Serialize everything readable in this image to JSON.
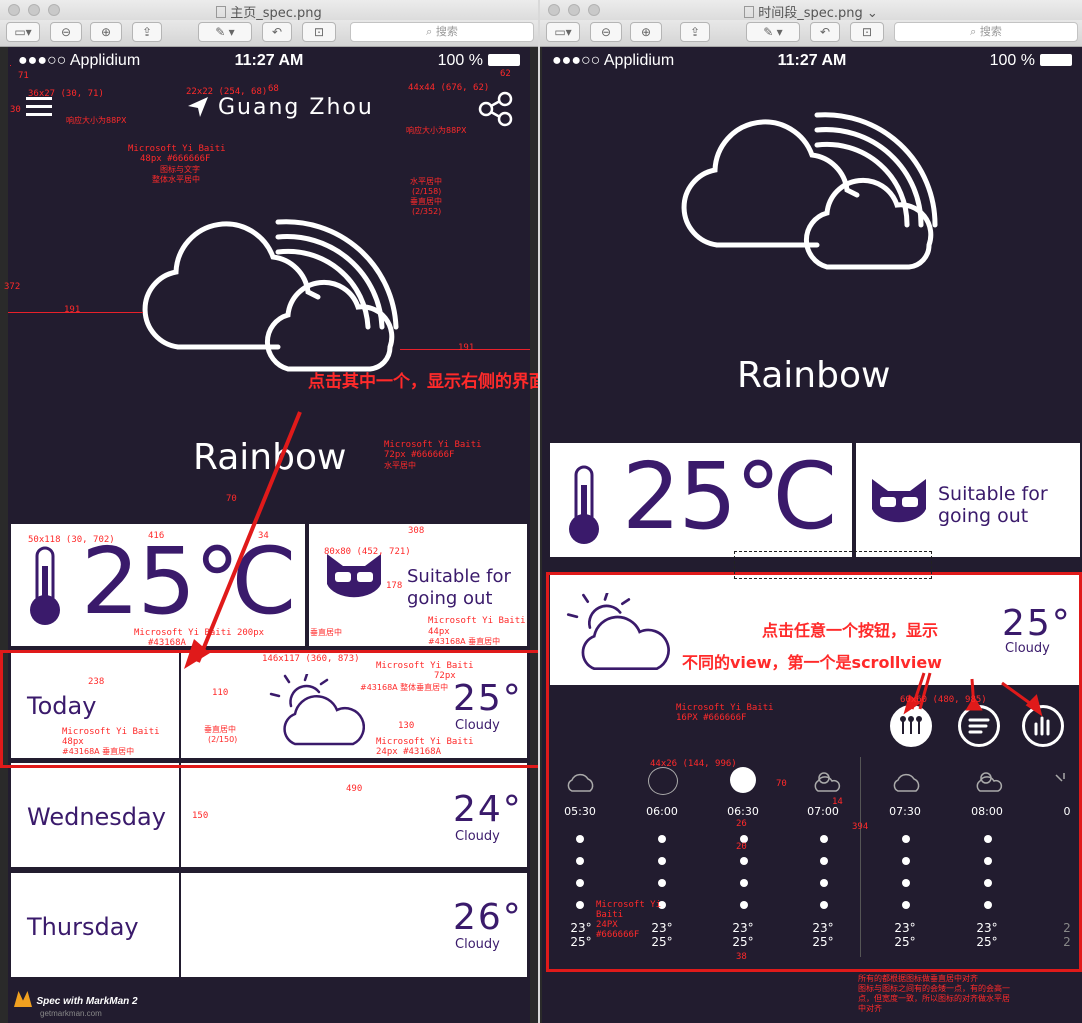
{
  "windows": {
    "left": {
      "title": "主页_spec.png",
      "search_placeholder": "搜索"
    },
    "right": {
      "title": "时间段_spec.png",
      "search_placeholder": "搜索"
    }
  },
  "status_bar": {
    "carrier": "●●●○○ Applidium",
    "time": "11:27 AM",
    "battery": "100 %"
  },
  "home": {
    "city": "Guang  Zhou",
    "weather": "Rainbow",
    "temperature": "25℃",
    "advice_line1": "Suitable for",
    "advice_line2": "going out",
    "days": [
      {
        "name": "Today",
        "temp": "25°",
        "cond": "Cloudy"
      },
      {
        "name": "Wednesday",
        "temp": "24°",
        "cond": "Cloudy"
      },
      {
        "name": "Thursday",
        "temp": "26°",
        "cond": "Cloudy"
      }
    ]
  },
  "detail": {
    "weather": "Rainbow",
    "temperature": "25℃",
    "advice_line1": "Suitable  for",
    "advice_line2": "going  out",
    "current_temp": "25°",
    "current_cond": "Cloudy",
    "timeline": [
      {
        "time": "05:30",
        "low": "23°",
        "high": "25°"
      },
      {
        "time": "06:00",
        "low": "23°",
        "high": "25°"
      },
      {
        "time": "06:30",
        "low": "23°",
        "high": "25°"
      },
      {
        "time": "07:00",
        "low": "23°",
        "high": "25°"
      },
      {
        "time": "07:30",
        "low": "23°",
        "high": "25°"
      },
      {
        "time": "08:00",
        "low": "23°",
        "high": "25°"
      },
      {
        "time": "0",
        "low": "2",
        "high": "2"
      }
    ]
  },
  "annotations": {
    "callout_left": "点击其中一个，显示右侧的界面",
    "callout_right_1": "点击任意一个按钮，显示",
    "callout_right_2": "不同的view，第一个是scrollview",
    "menu_spec": "36x27 (30, 71)",
    "menu_resp": "响应大小为88PX",
    "loc_spec": "22x22 (254, 68)",
    "share_spec": "44x44 (676, 62)",
    "share_resp": "响应大小为88PX",
    "city_font": "Microsoft Yi Baiti",
    "city_font_2": "48px    #666666F",
    "city_font_3": "图标与文字",
    "city_font_4": "整体水平居中",
    "icon_note_1": "水平居中",
    "icon_note_2": "(2/158)",
    "icon_note_3": "垂直居中",
    "icon_note_4": "(2/352)",
    "rainbow_font": "Microsoft Yi Baiti",
    "rainbow_font_2": "72px    #666666F",
    "rainbow_font_3": "水平居中",
    "dim_71": "71",
    "dim_30": "30",
    "dim_68": "68",
    "dim_62": "62",
    "dim_372": "372",
    "dim_191": "191",
    "dim_191b": "191",
    "dim_70": "70",
    "dim_416": "416",
    "dim_308": "308",
    "dim_34": "34",
    "dim_178": "178",
    "dim_238": "238",
    "dim_110": "110",
    "dim_130": "130",
    "dim_490": "490",
    "dim_150": "150",
    "therm_spec": "50x118 (30, 702)",
    "cat_spec": "80x80 (452, 721)",
    "temp_font": "Microsoft Yi Baiti  200px",
    "temp_font_2": "#43168A",
    "temp_font_3": "垂直居中",
    "advice_font": "Microsoft Yi Baiti",
    "advice_font_2": "44px",
    "advice_font_3": "#43168A     垂直居中",
    "day_font": "Microsoft Yi Baiti",
    "day_font_2": "48px",
    "day_font_3": "#43168A     垂直居中",
    "cloud_spec": "146x117 (360, 873)",
    "cloud_note": "垂直居中",
    "cloud_note_2": "(2/150)",
    "small_temp_font": "Microsoft Yi Baiti",
    "small_temp_font_2": "72px",
    "small_temp_font_3": "#43168A   整体垂直居中",
    "cond_font": "Microsoft Yi Baiti",
    "cond_font_2": "24px    #43168A",
    "btn_spec": "60x60 (480, 985)",
    "tl_font": "Microsoft Yi Baiti",
    "tl_font_2": "16PX   #666666F",
    "tl_icon_spec": "44x26 (144, 996)",
    "tl_temp_font": "Microsoft Yi",
    "tl_temp_font_2": "Baiti",
    "tl_temp_font_3": "24PX",
    "tl_temp_font_4": "#666666F",
    "align_note_1": "所有的都根据图标做垂直居中对齐",
    "align_note_2": "图标与图标之间有的会矮一点，有的会高一",
    "align_note_3": "点，但宽度一致，所以图标的对齐做水平居",
    "align_note_4": "中对齐",
    "dim_70b": "70",
    "dim_14": "14",
    "dim_394": "394",
    "dim_26": "26",
    "dim_20": "20",
    "dim_38": "38"
  },
  "markman": {
    "brand": "Spec with MarkMan 2",
    "url": "getmarkman.com"
  },
  "colors": {
    "purple": "#3a1a6b",
    "background": "#221c2f",
    "annotation": "#ff2a2a"
  }
}
